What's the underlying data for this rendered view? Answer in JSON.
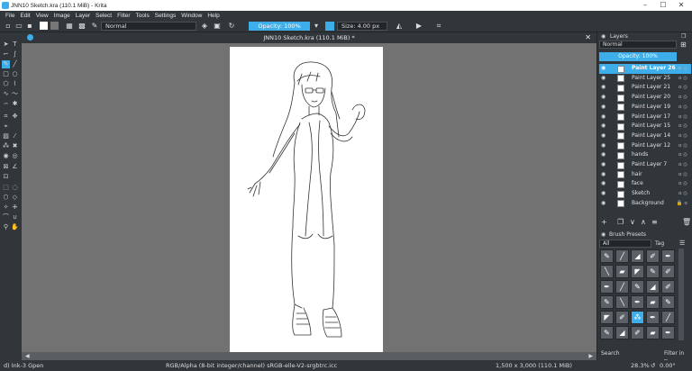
{
  "window": {
    "title": "JNN10 Sketch.kra (110.1 MiB) - Krita",
    "min": "–",
    "max": "☐",
    "close": "✕"
  },
  "menu": [
    "File",
    "Edit",
    "View",
    "Image",
    "Layer",
    "Select",
    "Filter",
    "Tools",
    "Settings",
    "Window",
    "Help"
  ],
  "toolbar": {
    "blend_mode": "Normal",
    "opacity": "Opacity: 100%",
    "size": "Size: 4.00 px"
  },
  "document": {
    "tab_title": "JNN10 Sketch.kra (110.1 MiB) *"
  },
  "status": {
    "brush": "d) Ink-3 Gpen",
    "color_model": "RGB/Alpha (8-bit integer/channel)  sRGB-elle-V2-srgbtrc.icc",
    "doc_size": "1,500 x 3,000 (110.1 MiB)",
    "zoom": "28.3%",
    "rotation": "0.00°"
  },
  "layers_panel": {
    "title": "Layers",
    "blend_mode": "Normal",
    "opacity": "Opacity:  100%",
    "layers": [
      {
        "name": "Paint Layer 26",
        "selected": true
      },
      {
        "name": "Paint Layer 25"
      },
      {
        "name": "Paint Layer 21"
      },
      {
        "name": "Paint Layer 20"
      },
      {
        "name": "Paint Layer 19"
      },
      {
        "name": "Paint Layer 17"
      },
      {
        "name": "Paint Layer 15"
      },
      {
        "name": "Paint Layer 14"
      },
      {
        "name": "Paint Layer 12"
      },
      {
        "name": "hands"
      },
      {
        "name": "Paint Layer 7"
      },
      {
        "name": "hair"
      },
      {
        "name": "face"
      },
      {
        "name": "Sketch"
      },
      {
        "name": "Background"
      }
    ]
  },
  "brush_presets": {
    "title": "Brush Presets",
    "filter": "All",
    "tag": "Tag",
    "search": "Search",
    "filter_in_tag": "Filter in Tag"
  },
  "colors": {
    "accent": "#3daee9",
    "panel": "#31363b",
    "canvas_bg": "#727272"
  }
}
